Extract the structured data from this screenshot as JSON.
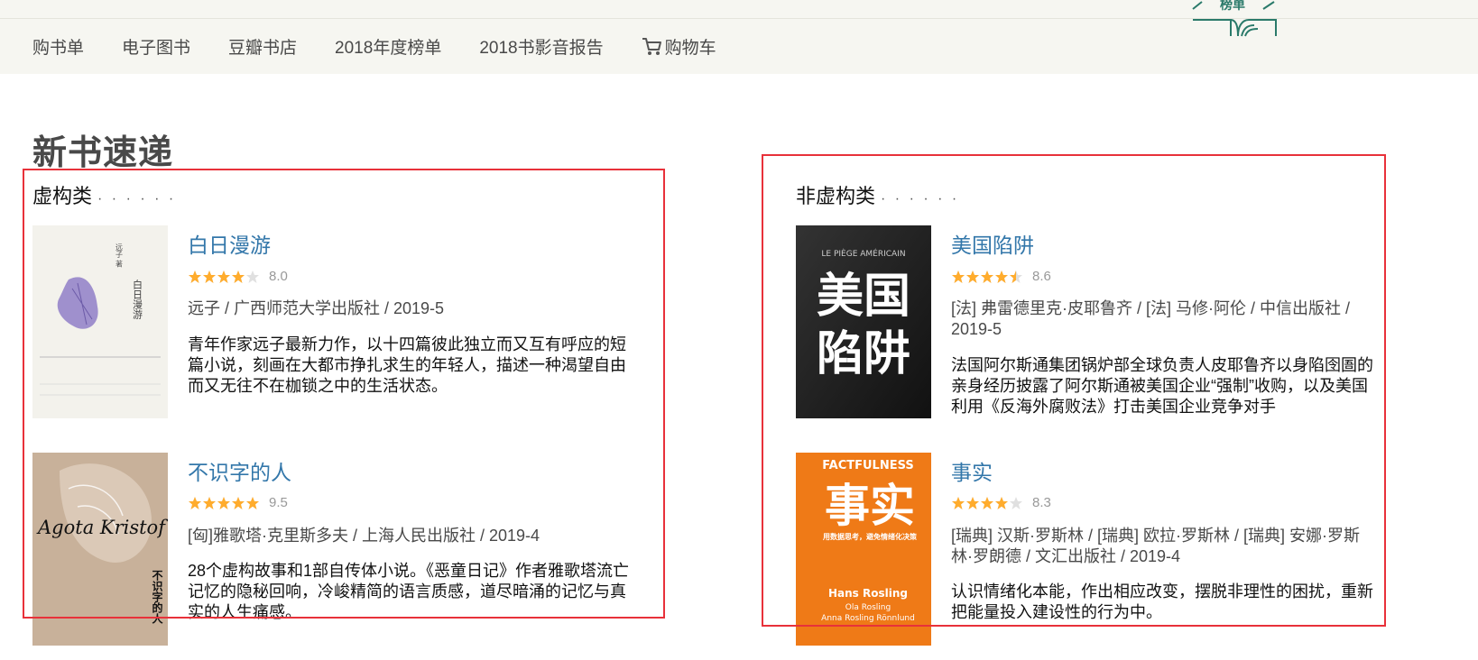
{
  "nav": {
    "items": [
      "购书单",
      "电子图书",
      "豆瓣书店",
      "2018年度榜单",
      "2018书影音报告"
    ],
    "cart_label": "购物车",
    "logo_text": "榜单"
  },
  "section_title": "新书速递",
  "fiction": {
    "heading": "虚构类",
    "dots": "· · · · · ·",
    "books": [
      {
        "title": "白日漫游",
        "stars": 4,
        "rating": "8.0",
        "meta": "远子 / 广西师范大学出版社 / 2019-5",
        "desc": "青年作家远子最新力作，以十四篇彼此独立而又互有呼应的短篇小说，刻画在大都市挣扎求生的年轻人，描述一种渴望自由而又无往不在枷锁之中的生活状态。",
        "cover_text": "白日漫游",
        "cover_author": "远子 著"
      },
      {
        "title": "不识字的人",
        "stars": 5,
        "rating": "9.5",
        "meta": "[匈]雅歌塔·克里斯多夫 / 上海人民出版社 / 2019-4",
        "desc": "28个虚构故事和1部自传体小说。《恶童日记》作者雅歌塔流亡记忆的隐秘回响，冷峻精简的语言质感，道尽暗涌的记忆与真实的人生痛感。",
        "cover_text": "Agota Kristof",
        "cover_cn": "不识字的人"
      }
    ]
  },
  "nonfiction": {
    "heading": "非虚构类",
    "dots": "· · · · · ·",
    "books": [
      {
        "title": "美国陷阱",
        "stars": 4.5,
        "rating": "8.6",
        "meta": "[法] 弗雷德里克·皮耶鲁齐 / [法] 马修·阿伦 / 中信出版社 / 2019-5",
        "desc": "法国阿尔斯通集团锅炉部全球负责人皮耶鲁齐以身陷囹圄的亲身经历披露了阿尔斯通被美国企业“强制”收购，以及美国利用《反海外腐败法》打击美国企业竞争对手",
        "cover_top": "LE PIÈGE AMÉRICAIN",
        "cover_line1": "美国",
        "cover_line2": "陷阱"
      },
      {
        "title": "事实",
        "stars": 4,
        "rating": "8.3",
        "meta": "[瑞典] 汉斯·罗斯林 / [瑞典] 欧拉·罗斯林 / [瑞典] 安娜·罗斯林·罗朗德 / 文汇出版社 / 2019-4",
        "desc": "认识情绪化本能，作出相应改变，摆脱非理性的困扰，重新把能量投入建设性的行为中。",
        "cover_top": "FACTFULNESS",
        "cover_big": "事实",
        "cover_sub": "用数据思考，避免情绪化决策",
        "cover_author1": "Hans Rosling",
        "cover_author2": "Ola Rosling",
        "cover_author3": "Anna Rosling Rönnlund"
      }
    ]
  },
  "colors": {
    "link": "#3377aa",
    "star": "#ffac2d",
    "star_empty": "#e0e0e0",
    "highlight_box": "#e8313a",
    "nav_bg": "#f6f6f1"
  }
}
